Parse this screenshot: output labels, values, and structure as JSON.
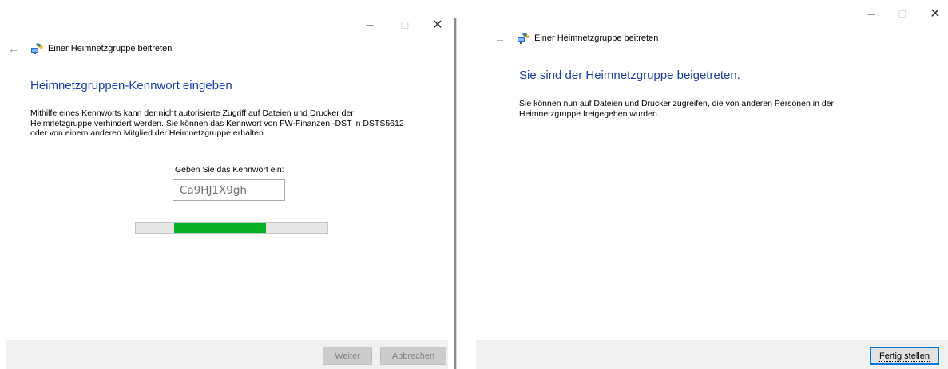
{
  "left_window": {
    "title": "Einer Heimnetzgruppe beitreten",
    "heading": "Heimnetzgruppen-Kennwort eingeben",
    "description_lines": [
      "Mithilfe eines Kennworts kann der nicht autorisierte Zugriff auf Dateien und Drucker der",
      "Heimnetzgruppe verhindert werden. Sie können das Kennwort von FW-Finanzen -DST in DSTS5612",
      "oder von einem anderen Mitglied der Heimnetzgruppe erhalten."
    ],
    "password_prompt": "Geben Sie das Kennwort ein:",
    "password_value": "Ca9HJ1X9gh",
    "progress": {
      "style": "marquee",
      "segment_start": 0.2,
      "segment_end": 0.68
    },
    "buttons": {
      "next": "Weiter",
      "cancel": "Abbrechen"
    }
  },
  "right_window": {
    "title": "Einer Heimnetzgruppe beitreten",
    "heading": "Sie sind der Heimnetzgruppe beigetreten.",
    "description_lines": [
      "Sie können nun auf Dateien und Drucker zugreifen, die von anderen Personen in der",
      "Heimnetzgruppe freigegeben wurden."
    ],
    "buttons": {
      "finish": "Fertig stellen"
    }
  },
  "caption": {
    "minimize": "–",
    "maximize": "☐",
    "close": "✕"
  },
  "colors": {
    "heading": "#1b3ea6",
    "progress": "#06b025",
    "accent": "#0078d7"
  },
  "icons": {
    "back": "back-arrow-icon",
    "app": "homegroup-icon"
  }
}
